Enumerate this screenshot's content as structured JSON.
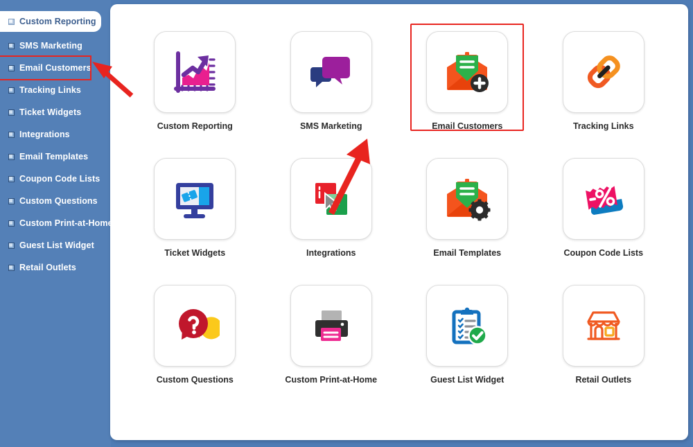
{
  "colors": {
    "page_background": "#4f7cb5",
    "sidebar_background": "#5480b7",
    "panel_background": "#ffffff",
    "highlight_red": "#e8241f",
    "sidebar_text": "#ffffff",
    "active_item_text": "#3d5f8f",
    "card_label_text": "#2a2a2a"
  },
  "sidebar": {
    "items": [
      {
        "label": "Custom Reporting",
        "icon": "square-bullet-icon",
        "state": "active"
      },
      {
        "label": "SMS Marketing",
        "icon": "square-bullet-icon",
        "state": "default"
      },
      {
        "label": "Email Customers",
        "icon": "square-bullet-icon",
        "state": "highlighted"
      },
      {
        "label": "Tracking Links",
        "icon": "square-bullet-icon",
        "state": "default"
      },
      {
        "label": "Ticket Widgets",
        "icon": "square-bullet-icon",
        "state": "default"
      },
      {
        "label": "Integrations",
        "icon": "square-bullet-icon",
        "state": "default"
      },
      {
        "label": "Email Templates",
        "icon": "square-bullet-icon",
        "state": "default"
      },
      {
        "label": "Coupon Code Lists",
        "icon": "square-bullet-icon",
        "state": "default"
      },
      {
        "label": "Custom Questions",
        "icon": "square-bullet-icon",
        "state": "default"
      },
      {
        "label": "Custom Print-at-Home",
        "icon": "square-bullet-icon",
        "state": "default"
      },
      {
        "label": "Guest List Widget",
        "icon": "square-bullet-icon",
        "state": "default"
      },
      {
        "label": "Retail Outlets",
        "icon": "square-bullet-icon",
        "state": "default"
      }
    ]
  },
  "main": {
    "cards": [
      {
        "label": "Custom Reporting",
        "icon": "chart-growth-icon",
        "highlighted": false
      },
      {
        "label": "SMS Marketing",
        "icon": "speech-bubbles-icon",
        "highlighted": false
      },
      {
        "label": "Email Customers",
        "icon": "envelope-plus-icon",
        "highlighted": true
      },
      {
        "label": "Tracking Links",
        "icon": "chain-link-icon",
        "highlighted": false
      },
      {
        "label": "Ticket Widgets",
        "icon": "monitor-ticket-icon",
        "highlighted": false
      },
      {
        "label": "Integrations",
        "icon": "overlapping-squares-cursor-icon",
        "highlighted": false
      },
      {
        "label": "Email Templates",
        "icon": "envelope-gear-icon",
        "highlighted": false
      },
      {
        "label": "Coupon Code Lists",
        "icon": "coupon-percent-icon",
        "highlighted": false
      },
      {
        "label": "Custom Questions",
        "icon": "question-bubble-icon",
        "highlighted": false
      },
      {
        "label": "Custom Print-at-Home",
        "icon": "printer-icon",
        "highlighted": false
      },
      {
        "label": "Guest List Widget",
        "icon": "clipboard-check-icon",
        "highlighted": false
      },
      {
        "label": "Retail Outlets",
        "icon": "storefront-icon",
        "highlighted": false
      }
    ]
  },
  "annotations": {
    "arrows": [
      {
        "name": "arrow-to-sidebar-email-customers",
        "points_to": "Email Customers",
        "color": "#e8241f"
      },
      {
        "name": "arrow-to-card-email-customers",
        "points_to": "Email Customers",
        "color": "#e8241f"
      }
    ],
    "boxes": [
      {
        "name": "box-sidebar-email-customers",
        "target": "Email Customers",
        "color": "#e8241f"
      },
      {
        "name": "box-card-email-customers",
        "target": "Email Customers",
        "color": "#e8241f"
      }
    ]
  }
}
